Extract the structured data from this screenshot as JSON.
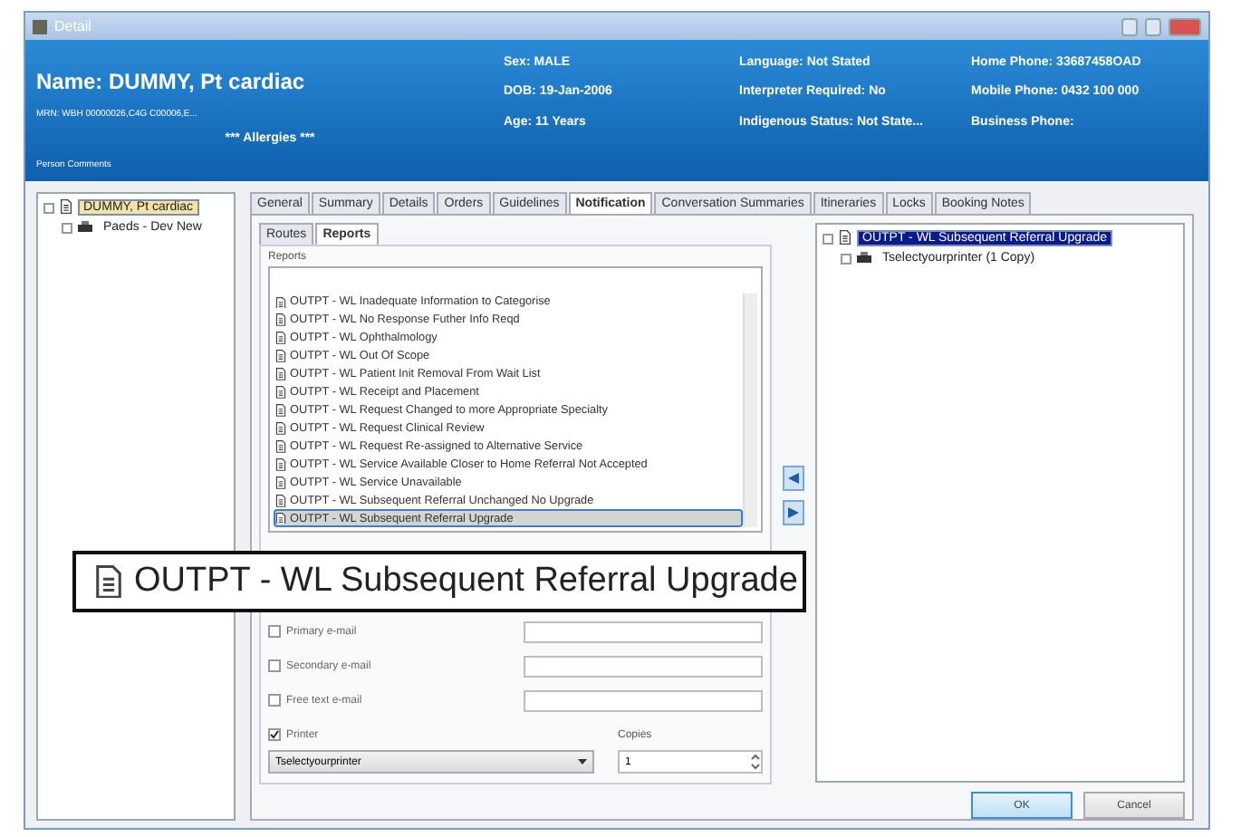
{
  "window": {
    "title": "Detail"
  },
  "header": {
    "name": "Name: DUMMY, Pt cardiac",
    "mrn": "MRN: WBH 00000026,C4G C00006,E...",
    "allergies": "*** Allergies ***",
    "comments": "Person Comments",
    "columns": [
      [
        "Sex: MALE",
        "DOB: 19-Jan-2006",
        "Age: 11 Years"
      ],
      [
        "Language: Not Stated",
        "Interpreter Required: No",
        "Indigenous Status: Not State..."
      ],
      [
        "Home Phone: 33687458OAD",
        "Mobile Phone: 0432 100 000",
        "Business Phone:"
      ]
    ]
  },
  "left_tree": [
    {
      "label": "DUMMY, Pt cardiac",
      "selected": true,
      "children": [
        {
          "label": "Paeds - Dev New",
          "selected": false
        }
      ]
    }
  ],
  "tabs": [
    {
      "label": "General",
      "selected": false
    },
    {
      "label": "Summary",
      "selected": false
    },
    {
      "label": "Details",
      "selected": false
    },
    {
      "label": "Orders",
      "selected": false
    },
    {
      "label": "Guidelines",
      "selected": false
    },
    {
      "label": "Notification",
      "selected": true
    },
    {
      "label": "Conversation Summaries",
      "selected": false
    },
    {
      "label": "Itineraries",
      "selected": false
    },
    {
      "label": "Locks",
      "selected": false
    },
    {
      "label": "Booking Notes",
      "selected": false
    }
  ],
  "subtabs": [
    {
      "label": "Routes",
      "selected": false
    },
    {
      "label": "Reports",
      "selected": true
    }
  ],
  "reports": {
    "label": "Reports",
    "items": [
      {
        "label": "OUTPT - WL Inadequate Information to Categorise",
        "selected": false
      },
      {
        "label": "OUTPT - WL No Response Futher Info Reqd",
        "selected": false
      },
      {
        "label": "OUTPT - WL Ophthalmology",
        "selected": false
      },
      {
        "label": "OUTPT - WL Out Of Scope",
        "selected": false
      },
      {
        "label": "OUTPT - WL Patient Init Removal From Wait List",
        "selected": false
      },
      {
        "label": "OUTPT - WL Receipt and Placement",
        "selected": false
      },
      {
        "label": "OUTPT - WL Request Changed to more Appropriate Specialty",
        "selected": false
      },
      {
        "label": "OUTPT - WL Request Clinical Review",
        "selected": false
      },
      {
        "label": "OUTPT - WL Request Re-assigned to Alternative Service",
        "selected": false
      },
      {
        "label": "OUTPT - WL Service Available Closer to Home Referral Not Accepted",
        "selected": false
      },
      {
        "label": "OUTPT - WL Service Unavailable",
        "selected": false
      },
      {
        "label": "OUTPT - WL Subsequent Referral Unchanged No Upgrade",
        "selected": false
      },
      {
        "label": "OUTPT - WL Subsequent Referral Upgrade",
        "selected": true
      }
    ]
  },
  "options": [
    {
      "label": "Primary e-mail",
      "checked": false
    },
    {
      "label": "Secondary e-mail",
      "checked": false
    },
    {
      "label": "Free text e-mail",
      "checked": false
    }
  ],
  "printer": {
    "label": "Printer",
    "checked": true,
    "value": "Tselectyourprinter",
    "copies_label": "Copies",
    "copies": "1"
  },
  "right_tree": [
    {
      "label": "OUTPT - WL Subsequent Referral Upgrade",
      "selected": true,
      "children": [
        {
          "label": "Tselectyourprinter (1 Copy)",
          "selected": false
        }
      ]
    }
  ],
  "callout": {
    "label": "OUTPT - WL Subsequent Referral Upgrade"
  },
  "buttons": [
    "OK",
    "Cancel"
  ]
}
